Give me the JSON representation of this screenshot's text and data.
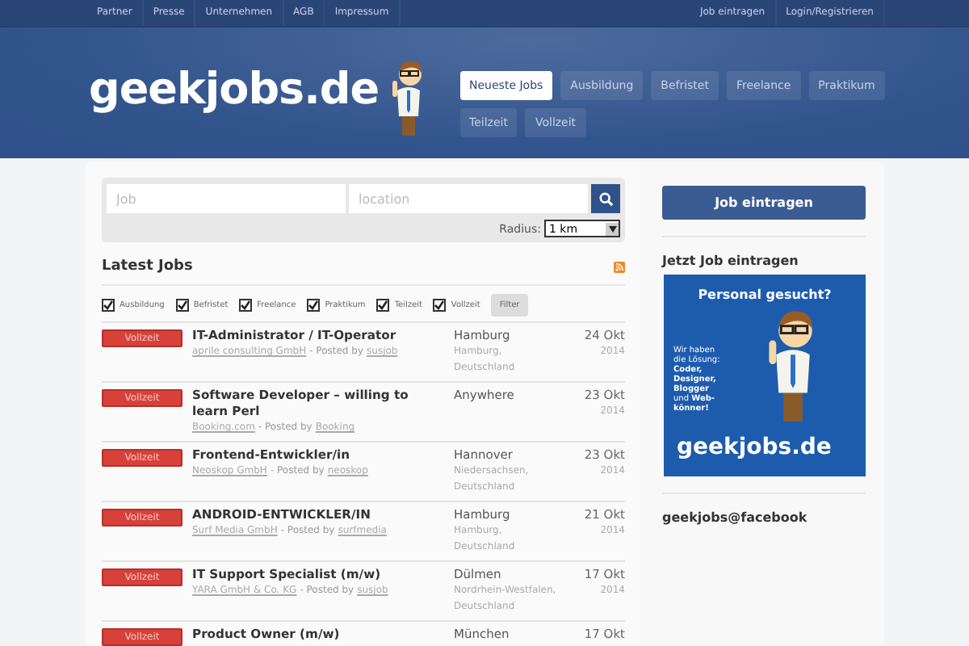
{
  "top_bar": {
    "left_links": [
      "Partner",
      "Presse",
      "Unternehmen",
      "AGB",
      "Impressum"
    ],
    "right_links": [
      "Job eintragen",
      "Login/Registrieren"
    ]
  },
  "header": {
    "logo": "geekjobs.de",
    "nav": [
      {
        "label": "Neueste Jobs",
        "selected": true
      },
      {
        "label": "Ausbildung",
        "selected": false
      },
      {
        "label": "Befristet",
        "selected": false
      },
      {
        "label": "Freelance",
        "selected": false
      },
      {
        "label": "Praktikum",
        "selected": false
      },
      {
        "label": "Teilzeit",
        "selected": false
      },
      {
        "label": "Vollzeit",
        "selected": false
      }
    ]
  },
  "search": {
    "job_placeholder": "Job",
    "location_placeholder": "location",
    "radius_label": "Radius:",
    "radius_value": "1 km"
  },
  "latest_jobs": {
    "title": "Latest Jobs",
    "filters": [
      {
        "label": "Ausbildung",
        "checked": true
      },
      {
        "label": "Befristet",
        "checked": true
      },
      {
        "label": "Freelance",
        "checked": true
      },
      {
        "label": "Praktikum",
        "checked": true
      },
      {
        "label": "Teilzeit",
        "checked": true
      },
      {
        "label": "Vollzeit",
        "checked": true
      }
    ],
    "filter_button": "Filter",
    "jobs": [
      {
        "type": "Vollzeit",
        "title": "IT-Administrator / IT-Operator",
        "company": "aprile consulting GmbH",
        "posted_by": "- Posted by",
        "user": "susjob",
        "city": "Hamburg",
        "region": "Hamburg, Deutschland",
        "date": "24 Okt",
        "year": "2014"
      },
      {
        "type": "Vollzeit",
        "title": "Software Developer – willing to learn Perl",
        "company": "Booking.com",
        "posted_by": "- Posted by",
        "user": "Booking",
        "city": "Anywhere",
        "date": "23 Okt",
        "year": "2014"
      },
      {
        "type": "Vollzeit",
        "title": "Frontend-Entwickler/in",
        "company": "Neoskop GmbH",
        "posted_by": "- Posted by",
        "user": "neoskop",
        "city": "Hannover",
        "region": "Niedersachsen, Deutschland",
        "date": "23 Okt",
        "year": "2014"
      },
      {
        "type": "Vollzeit",
        "title": "ANDROID-ENTWICKLER/IN",
        "company": "Surf Media GmbH",
        "posted_by": "- Posted by",
        "user": "surfmedia",
        "city": "Hamburg",
        "region": "Hamburg, Deutschland",
        "date": "21 Okt",
        "year": "2014"
      },
      {
        "type": "Vollzeit",
        "title": "IT Support Specialist (m/w)",
        "company": "YARA GmbH & Co. KG",
        "posted_by": "- Posted by",
        "user": "susjob",
        "city": "Dülmen",
        "region": "Nordrhein-Westfalen, Deutschland",
        "date": "17 Okt",
        "year": "2014"
      },
      {
        "type": "Vollzeit",
        "title": "Product Owner (m/w)",
        "city": "München",
        "date": "17 Okt"
      }
    ]
  },
  "sidebar": {
    "post_button": "Job eintragen",
    "post_heading": "Jetzt Job eintragen",
    "banner": {
      "headline": "Personal gesucht?",
      "pitch": "Wir haben die Lösung: **Coder, Designer, Blogger** und **Web-könner!**",
      "logo": "geekjobs.de"
    },
    "facebook_heading": "geekjobs@facebook"
  }
}
